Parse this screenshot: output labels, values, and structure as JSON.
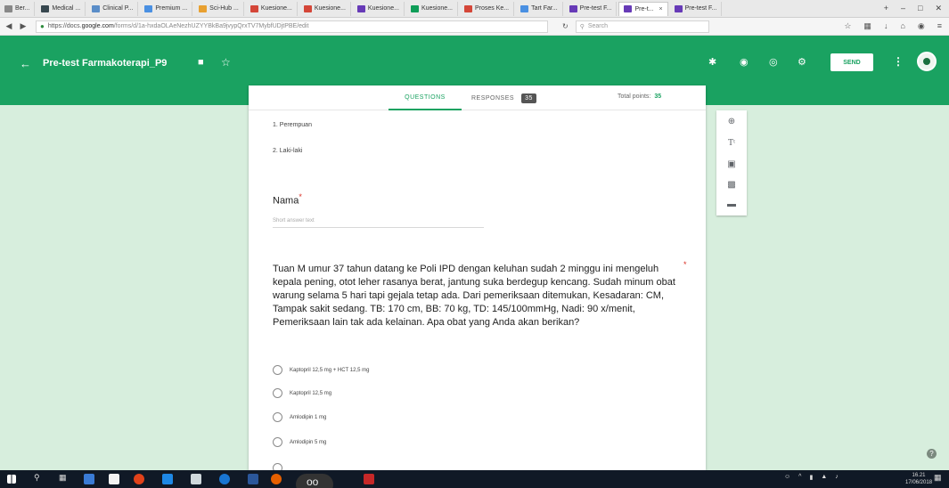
{
  "browser": {
    "tabs": [
      {
        "label": "Ber...",
        "color": "#888888"
      },
      {
        "label": "Medical ...",
        "color": "#37474f"
      },
      {
        "label": "Clinical P...",
        "color": "#5a8dc8"
      },
      {
        "label": "Premium ...",
        "color": "#4a90e2"
      },
      {
        "label": "Sci-Hub ...",
        "color": "#e8a030"
      },
      {
        "label": "Kuesione...",
        "color": "#d44638"
      },
      {
        "label": "Kuesione...",
        "color": "#d44638"
      },
      {
        "label": "Kuesione...",
        "color": "#673ab7"
      },
      {
        "label": "Kuesione...",
        "color": "#0f9d58"
      },
      {
        "label": "Proses Ke...",
        "color": "#d44638"
      },
      {
        "label": "Tart Far...",
        "color": "#4a90e2"
      },
      {
        "label": "Pre-test F...",
        "color": "#673ab7"
      },
      {
        "label": "Pre-t...",
        "color": "#673ab7",
        "active": true
      },
      {
        "label": "Pre-test F...",
        "color": "#673ab7"
      }
    ],
    "url": {
      "prefix": "https://docs.",
      "domain": "google.com",
      "rest": "/forms/d/1a-hxdaOLAeNezhUZYYBkBa9jvypQrxTV7MybfUDjtPBE/edit"
    },
    "search_placeholder": "Search"
  },
  "form_header": {
    "title": "Pre-test Farmakoterapi_P9",
    "send_label": "SEND"
  },
  "tabs": {
    "questions": "QUESTIONS",
    "responses": "RESPONSES",
    "responses_count": "35",
    "total_points_label": "Total points:",
    "total_points": "35"
  },
  "previous_options": [
    "1. Perempuan",
    "2. Laki-laki"
  ],
  "name_question": {
    "label": "Nama",
    "required_mark": "*",
    "placeholder": "Short answer text"
  },
  "question": {
    "text": "Tuan M umur 37 tahun datang ke Poli IPD dengan keluhan sudah 2 minggu ini mengeluh kepala pening, otot leher rasanya berat, jantung suka berdegup kencang. Sudah minum obat warung selama 5 hari tapi gejala tetap ada. Dari pemeriksaan ditemukan, Kesadaran: CM, Tampak sakit sedang. TB: 170 cm, BB: 70 kg, TD: 145/100mmHg, Nadi: 90 x/menit, Pemeriksaan lain tak ada kelainan. Apa obat yang Anda akan berikan?",
    "required_mark": "*",
    "choices": [
      "Kaptopril 12,5 mg + HCT 12,5 mg",
      "Kaptopril 12,5 mg",
      "Amlodipin 1 mg",
      "Amlodipin 5 mg"
    ]
  },
  "side_toolbar": [
    "add-question",
    "add-title",
    "add-image",
    "add-video",
    "add-section"
  ],
  "taskbar": {
    "badge": "oo",
    "clock_time": "16.21",
    "clock_date": "17/06/2018"
  },
  "colors": {
    "brand_green": "#1aa261",
    "background": "#d7eedd",
    "required_red": "#d93025"
  }
}
